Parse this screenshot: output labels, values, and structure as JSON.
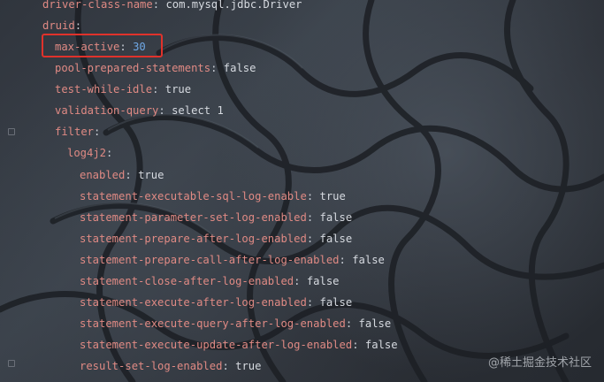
{
  "editor": {
    "lines": [
      {
        "key": "driver-class-name",
        "value": "com.mysql.jdbc.Driver",
        "type": "plain"
      },
      {
        "key": "druid",
        "value": "",
        "type": "plain"
      },
      {
        "key": "max-active",
        "value": "30",
        "type": "num"
      },
      {
        "key": "pool-prepared-statements",
        "value": "false",
        "type": "plain"
      },
      {
        "key": "test-while-idle",
        "value": "true",
        "type": "plain"
      },
      {
        "key": "validation-query",
        "value": "select 1",
        "type": "plain"
      },
      {
        "key": "filter",
        "value": "",
        "type": "plain"
      },
      {
        "key": "log4j2",
        "value": "",
        "type": "plain"
      },
      {
        "key": "enabled",
        "value": "true",
        "type": "plain"
      },
      {
        "key": "statement-executable-sql-log-enable",
        "value": "true",
        "type": "plain"
      },
      {
        "key": "statement-parameter-set-log-enabled",
        "value": "false",
        "type": "plain"
      },
      {
        "key": "statement-prepare-after-log-enabled",
        "value": "false",
        "type": "plain"
      },
      {
        "key": "statement-prepare-call-after-log-enabled",
        "value": "false",
        "type": "plain"
      },
      {
        "key": "statement-close-after-log-enabled",
        "value": "false",
        "type": "plain"
      },
      {
        "key": "statement-execute-after-log-enabled",
        "value": "false",
        "type": "plain"
      },
      {
        "key": "statement-execute-query-after-log-enabled",
        "value": "false",
        "type": "plain"
      },
      {
        "key": "statement-execute-update-after-log-enabled",
        "value": "false",
        "type": "plain"
      },
      {
        "key": "result-set-log-enabled",
        "value": "true",
        "type": "plain"
      }
    ],
    "highlighted_line": "max-active",
    "highlight_color": "#e0322b"
  },
  "gutter": {
    "icons": [
      "fold-icon",
      "fold-icon"
    ]
  },
  "watermark": {
    "text": "@稀土掘金技术社区"
  },
  "colors": {
    "key": "#e08a84",
    "value": "#d6dae0",
    "number": "#6fa8e6"
  }
}
